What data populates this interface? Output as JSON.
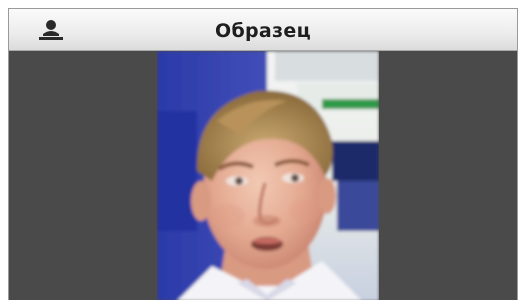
{
  "header": {
    "title": "Образец",
    "icon": "user-icon"
  },
  "photo": {
    "description_icon": "face-photo"
  },
  "colors": {
    "panel_background": "#4a4a4a",
    "header_background": "#ececec",
    "title_text": "#1e1e1e"
  }
}
